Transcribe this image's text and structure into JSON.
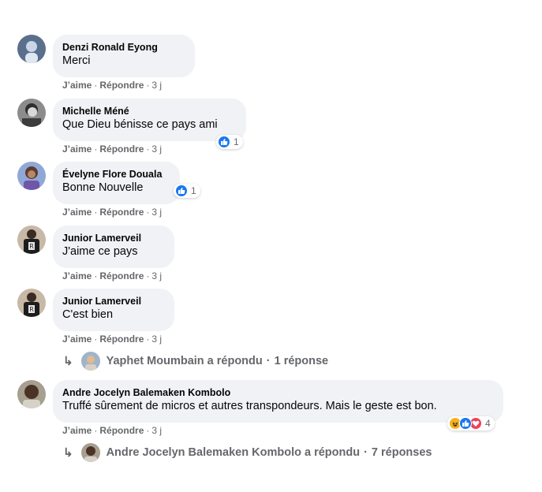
{
  "comments": [
    {
      "author": "Denzi Ronald Eyong",
      "text": "Merci",
      "like": "J’aime",
      "reply": "Répondre",
      "time": "3 j"
    },
    {
      "author": "Michelle Méné",
      "text": "Que Dieu bénisse ce pays ami",
      "like": "J’aime",
      "reply": "Répondre",
      "time": "3 j",
      "reaction_count": "1"
    },
    {
      "author": "Évelyne Flore Douala",
      "text": "Bonne Nouvelle",
      "like": "J’aime",
      "reply": "Répondre",
      "time": "3 j",
      "reaction_count": "1"
    },
    {
      "author": "Junior Lamerveil",
      "text": "J'aime ce pays",
      "like": "J’aime",
      "reply": "Répondre",
      "time": "3 j"
    },
    {
      "author": "Junior Lamerveil",
      "text": "C'est bien",
      "like": "J’aime",
      "reply": "Répondre",
      "time": "3 j",
      "replies": {
        "name": "Yaphet Moumbain a répondu",
        "count": "1 réponse"
      }
    },
    {
      "author": "Andre Jocelyn Balemaken Kombolo",
      "text": "Truffé sûrement de micros et autres transpondeurs. Mais le geste est bon.",
      "like": "J’aime",
      "reply": "Répondre",
      "time": "3 j",
      "reaction_count": "4",
      "replies": {
        "name": "Andre Jocelyn Balemaken Kombolo a répondu",
        "count": "7 réponses"
      }
    }
  ],
  "separators": {
    "dot": "·"
  },
  "icons": {
    "reply_arrow": "reply-arrow-icon",
    "like": "like-reaction-icon",
    "haha": "haha-reaction-icon",
    "love": "love-reaction-icon"
  },
  "colors": {
    "bubble_bg": "#f0f2f5",
    "meta_text": "#65676b",
    "like_blue": "#1877f2",
    "love_red": "#f33e58",
    "haha_yellow": "#f7b125"
  }
}
